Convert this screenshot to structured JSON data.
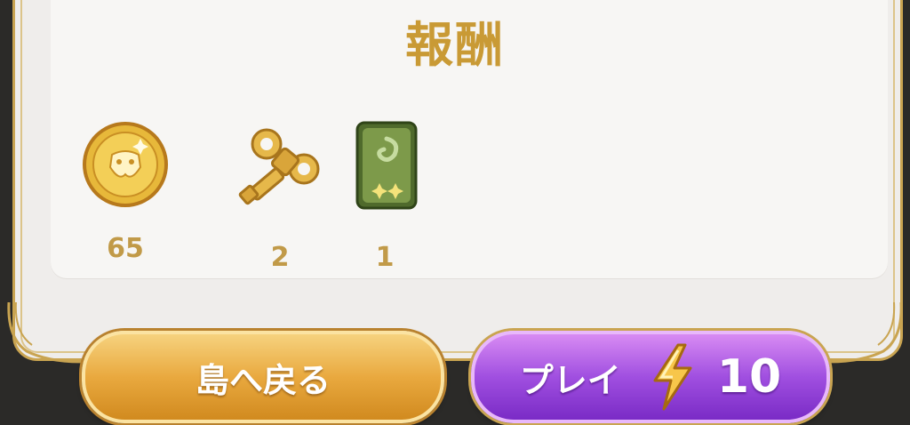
{
  "header": {
    "title": "報酬"
  },
  "rewards": [
    {
      "icon": "gold-coin-icon",
      "quantity": "65"
    },
    {
      "icon": "wind-up-key-icon",
      "quantity": "2"
    },
    {
      "icon": "green-card-pack-icon",
      "quantity": "1"
    }
  ],
  "buttons": {
    "back_label": "島へ戻る",
    "play_label": "プレイ",
    "play_cost": "10",
    "play_cost_icon": "lightning-bolt-icon"
  },
  "colors": {
    "title_gold": "#c99a35",
    "back_button_gold": "#e9a93f",
    "play_button_purple": "#a04fe0"
  }
}
